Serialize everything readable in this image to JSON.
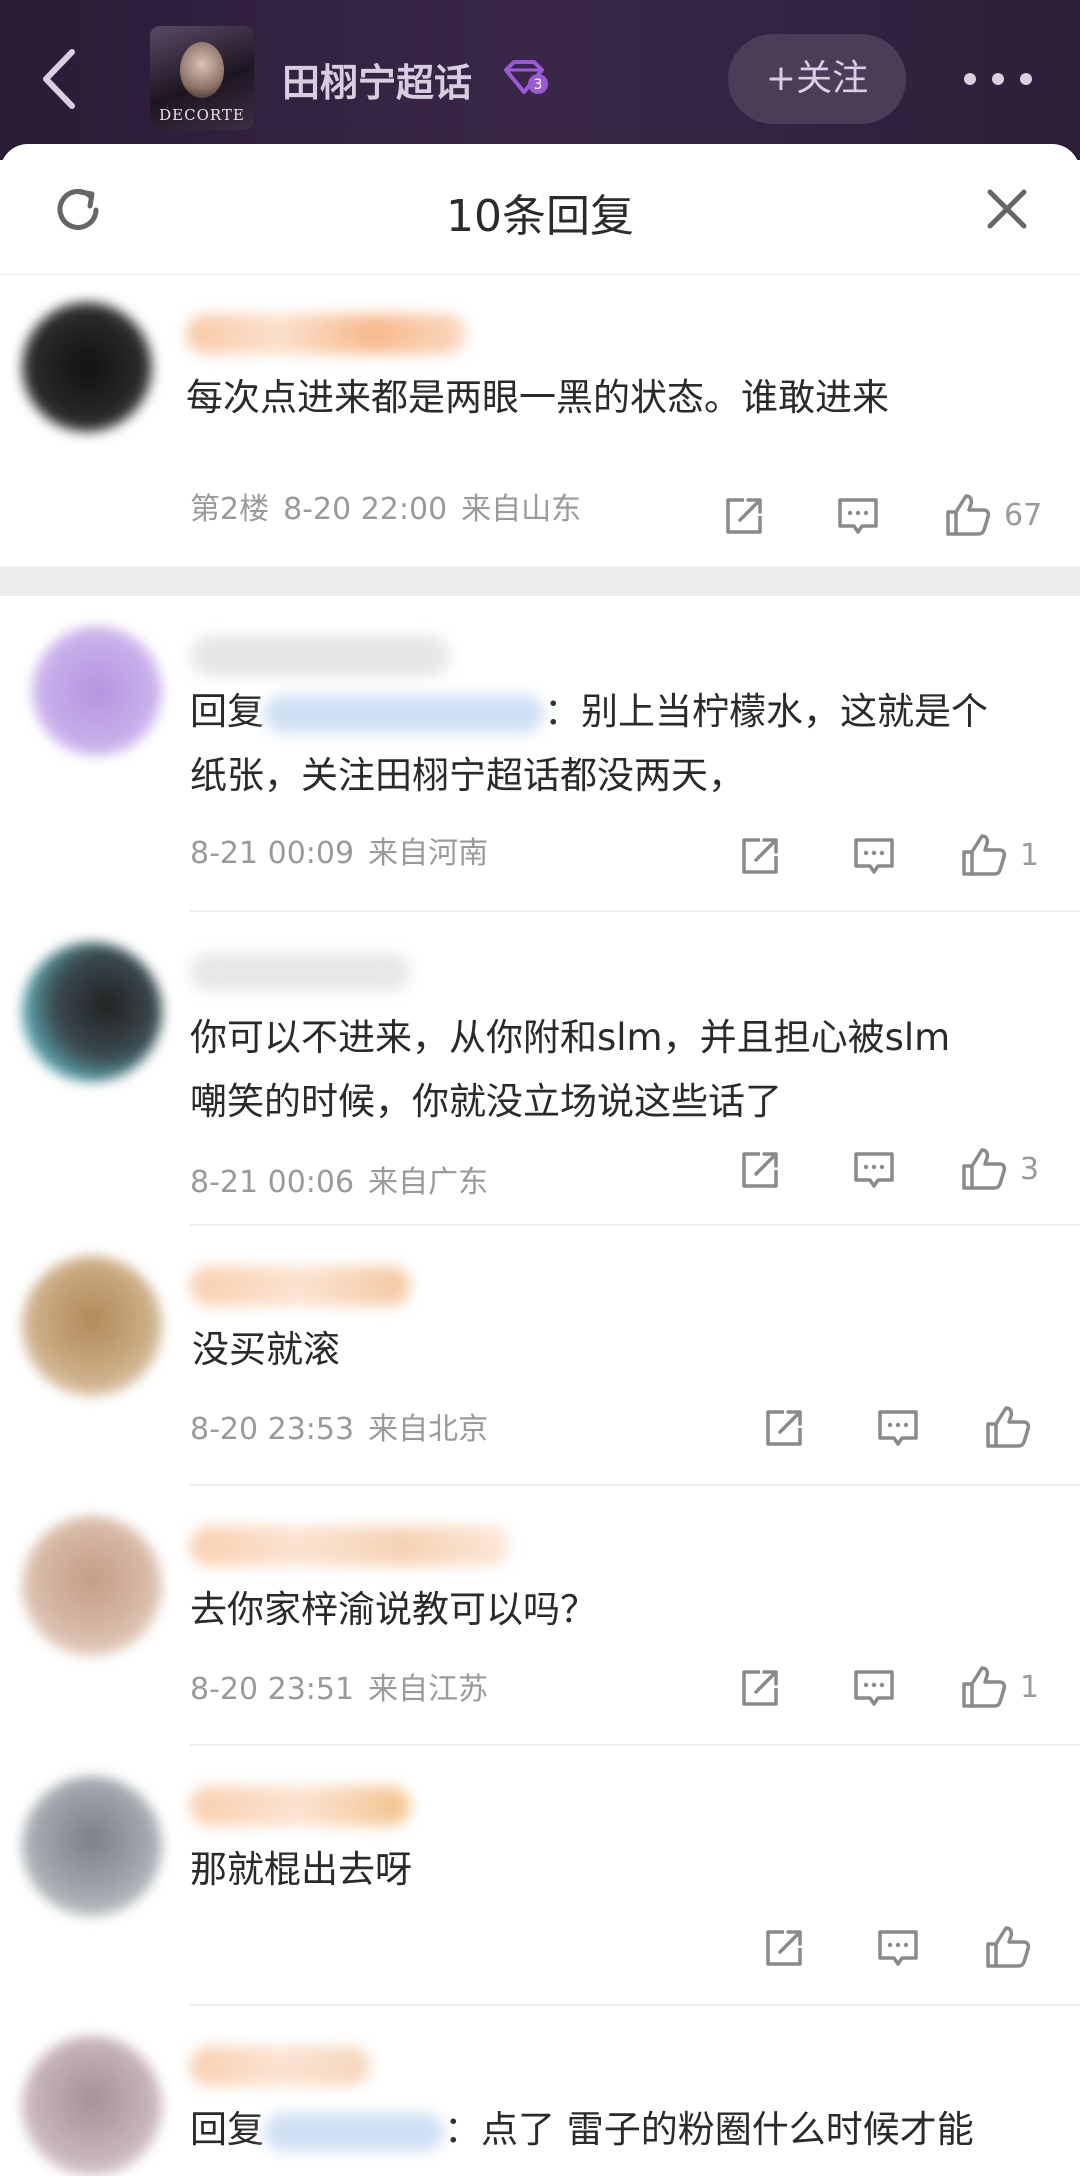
{
  "header": {
    "topic_title": "田栩宁超话",
    "cover_text": "DECORTE",
    "follow_label": "+关注",
    "badge_level": "3"
  },
  "sheet": {
    "title": "10条回复"
  },
  "comments": [
    {
      "text": "每次点进来都是两眼一黑的状态。谁敢进来",
      "floor": "第2楼",
      "time": "8-20 22:00",
      "location": "来自山东",
      "likes": "67"
    },
    {
      "reply_prefix": "回复",
      "text_after_reply": "：别上当柠檬水，这就是个",
      "text_line2": "纸张，关注田栩宁超话都没两天，",
      "time": "8-21 00:09",
      "location": "来自河南",
      "likes": "1"
    },
    {
      "text": "你可以不进来，从你附和slm，并且担心被slm",
      "text_line2": "嘲笑的时候，你就没立场说这些话了",
      "time": "8-21 00:06",
      "location": "来自广东",
      "likes": "3"
    },
    {
      "text": "没买就滚",
      "time": "8-20 23:53",
      "location": "来自北京",
      "likes": ""
    },
    {
      "text": "去你家梓渝说教可以吗？",
      "time": "8-20 23:51",
      "location": "来自江苏",
      "likes": "1"
    },
    {
      "text": "那就棍出去呀",
      "likes": ""
    },
    {
      "reply_prefix": "回复",
      "text_after_reply": "：点了 雷子的粉圈什么时候才能"
    }
  ],
  "colors": {
    "topbar": "#2a1b36",
    "follow_bg": "#4b3c58",
    "meta_text": "#9a9a9a",
    "badge": "#9b59d6"
  },
  "icons": [
    "back-arrow-icon",
    "more-dots-icon",
    "refresh-icon",
    "close-icon",
    "share-icon",
    "comment-icon",
    "like-icon",
    "diamond-badge-icon"
  ]
}
